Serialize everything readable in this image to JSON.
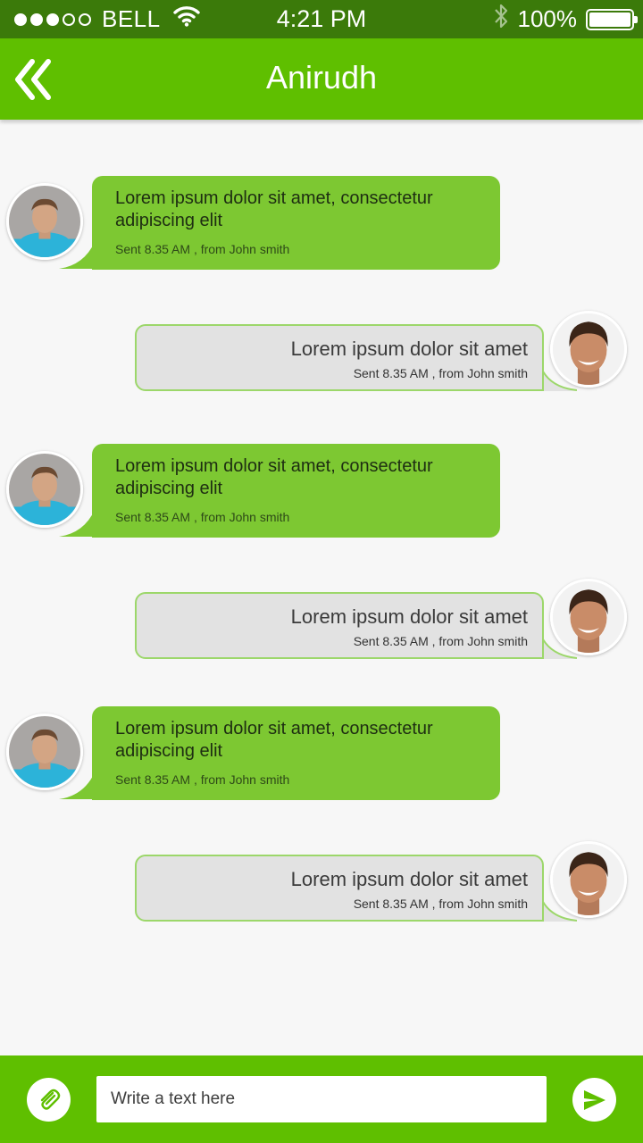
{
  "status_bar": {
    "signal_dots_filled": 3,
    "signal_dots_total": 5,
    "carrier": "BELL",
    "time": "4:21 PM",
    "battery": "100%"
  },
  "header": {
    "title": "Anirudh",
    "back_icon": "double-chevron-left-icon"
  },
  "messages": [
    {
      "direction": "incoming",
      "text": "Lorem ipsum dolor sit amet, consectetur adipiscing elit",
      "meta": "Sent 8.35 AM , from John smith"
    },
    {
      "direction": "outgoing",
      "text": "Lorem ipsum dolor sit amet",
      "meta": "Sent 8.35 AM , from John smith"
    },
    {
      "direction": "incoming",
      "text": "Lorem ipsum dolor sit amet, consectetur adipiscing elit",
      "meta": "Sent 8.35 AM , from John smith"
    },
    {
      "direction": "outgoing",
      "text": "Lorem ipsum dolor sit amet",
      "meta": "Sent 8.35 AM , from John smith"
    },
    {
      "direction": "incoming",
      "text": "Lorem ipsum dolor sit amet, consectetur adipiscing elit",
      "meta": "Sent 8.35 AM , from John smith"
    },
    {
      "direction": "outgoing",
      "text": "Lorem ipsum dolor sit amet",
      "meta": "Sent 8.35 AM , from John smith"
    }
  ],
  "composer": {
    "placeholder": "Write a text here",
    "value": "",
    "attach_icon": "paperclip-icon",
    "send_icon": "send-icon"
  },
  "colors": {
    "status_bar": "#3b7a0a",
    "header": "#5fbf00",
    "incoming_bubble": "#7dc832",
    "outgoing_bubble": "#e2e2e2",
    "outgoing_border": "#9cd76a",
    "background": "#f7f7f7"
  }
}
